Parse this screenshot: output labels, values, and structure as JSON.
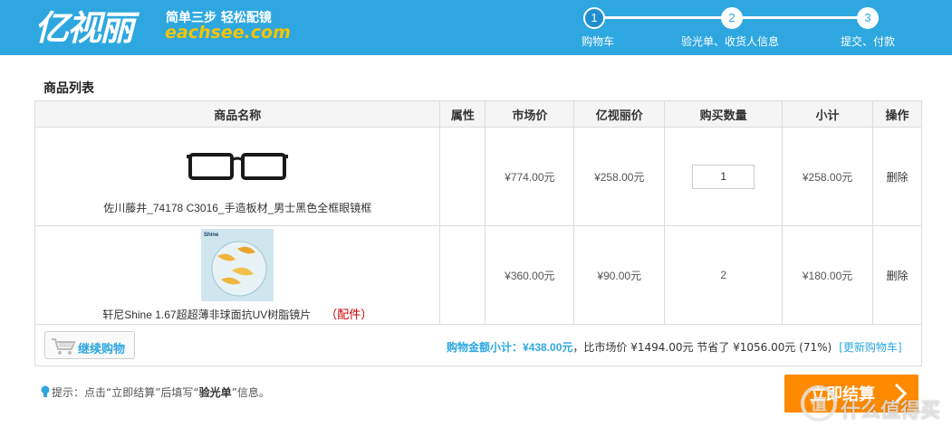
{
  "header": {
    "logo_text": "亿视丽",
    "slogan": "简单三步 轻松配镜",
    "domain": "eachsee.com",
    "steps": [
      {
        "number": "1",
        "label": "购物车"
      },
      {
        "number": "2",
        "label": "验光单、收货人信息"
      },
      {
        "number": "3",
        "label": "提交、付款"
      }
    ]
  },
  "section_title": "商品列表",
  "table": {
    "headers": [
      "商品名称",
      "属性",
      "市场价",
      "亿视丽价",
      "购买数量",
      "小计",
      "操作"
    ],
    "rows": [
      {
        "name": "佐川藤井_74178 C3016_手造板材_男士黑色全框眼镜框",
        "accessory": "",
        "attribute": "",
        "market_price": "¥774.00元",
        "price": "¥258.00元",
        "quantity": "1",
        "subtotal": "¥258.00元",
        "action": "删除",
        "image_icon": "eyeglasses-frame-image"
      },
      {
        "name": "轩尼Shine 1.67超超薄非球面抗UV树脂镜片",
        "accessory": "（配件）",
        "attribute": "",
        "market_price": "¥360.00元",
        "price": "¥90.00元",
        "quantity": "2",
        "subtotal": "¥180.00元",
        "action": "删除",
        "image_icon": "lens-product-image",
        "image_brand": "Shine"
      }
    ]
  },
  "footer": {
    "continue_label": "继续购物",
    "summary_label": "购物金额小计：",
    "summary_amount": "¥438.00元",
    "summary_compare": "，比市场价 ¥1494.00元 节省了 ¥1056.00元 (71%)",
    "update_cart": "[更新购物车]"
  },
  "tip": {
    "prefix": "提示：点击“立即结算”后填写“",
    "bold": "验光单",
    "suffix": "”信息。"
  },
  "checkout_label": "立即结算",
  "watermark_text": "什么值得买",
  "colors": {
    "header_bg": "#2ea7e0",
    "accent": "#2ea7e0",
    "checkout": "#ff8a00",
    "accessory": "#cc0000"
  }
}
